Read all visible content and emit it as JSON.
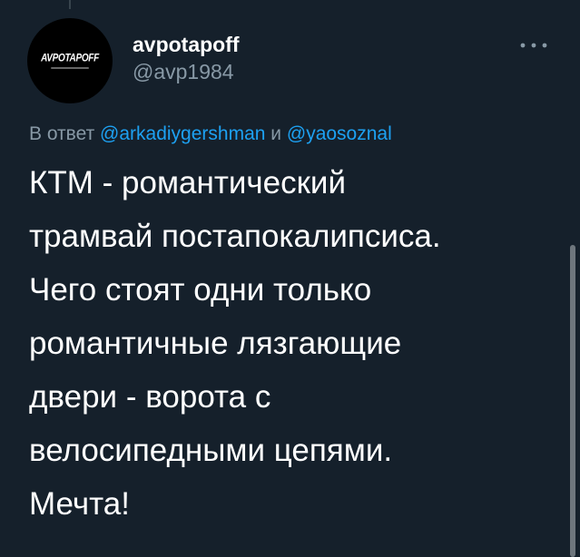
{
  "author": {
    "avatar_logo_text": "AVPOTAPOFF",
    "display_name": "avpotapoff",
    "handle": "@avp1984"
  },
  "reply_context": {
    "prefix": "В ответ",
    "mention_1": "@arkadiygershman",
    "conjunction": "и",
    "mention_2": "@yaosoznal"
  },
  "tweet": {
    "lines": [
      "КТМ - романтический",
      "трамвай постапокалипсиса.",
      "Чего стоят одни только",
      "романтичные лязгающие",
      "двери - ворота с",
      "велосипедными цепями.",
      "Мечта!"
    ]
  },
  "icons": {
    "more": "more-horizontal-icon"
  },
  "colors": {
    "background": "#15202b",
    "text_primary": "#ffffff",
    "text_secondary": "#8899a6",
    "link": "#1da1f2",
    "scrollbar": "#6e767d"
  }
}
